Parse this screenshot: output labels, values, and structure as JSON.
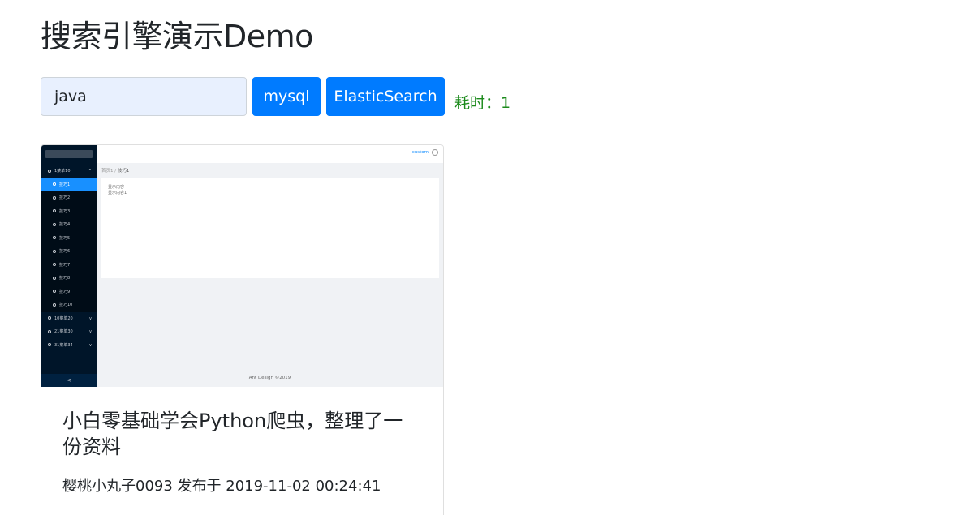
{
  "page": {
    "title": "搜索引擎演示Demo"
  },
  "search": {
    "value": "java",
    "placeholder": "",
    "mysql_label": "mysql",
    "es_label": "ElasticSearch",
    "elapsed_text": "耗时：1"
  },
  "results": [
    {
      "title": "小白零基础学会Python爬虫，整理了一份资料",
      "meta": "樱桃小丸子0093 发布于 2019-11-02 00:24:41",
      "thumbnail": {
        "header_link": "custom",
        "breadcrumb_root": "首页1",
        "breadcrumb_sep": "/",
        "breadcrumb_current": "技巧1",
        "content_lines": [
          "显示内容",
          "显示内容1"
        ],
        "footer": "Ant Design ©2019",
        "collapse": "<",
        "menu": [
          {
            "label": "1菜单10",
            "arrow": "^",
            "sub": false,
            "active": false
          },
          {
            "label": "技巧1",
            "arrow": "",
            "sub": true,
            "active": true
          },
          {
            "label": "技巧2",
            "arrow": "",
            "sub": true,
            "active": false
          },
          {
            "label": "技巧3",
            "arrow": "",
            "sub": true,
            "active": false
          },
          {
            "label": "技巧4",
            "arrow": "",
            "sub": true,
            "active": false
          },
          {
            "label": "技巧5",
            "arrow": "",
            "sub": true,
            "active": false
          },
          {
            "label": "技巧6",
            "arrow": "",
            "sub": true,
            "active": false
          },
          {
            "label": "技巧7",
            "arrow": "",
            "sub": true,
            "active": false
          },
          {
            "label": "技巧8",
            "arrow": "",
            "sub": true,
            "active": false
          },
          {
            "label": "技巧9",
            "arrow": "",
            "sub": true,
            "active": false
          },
          {
            "label": "技巧10",
            "arrow": "",
            "sub": true,
            "active": false
          },
          {
            "label": "10菜单20",
            "arrow": "v",
            "sub": false,
            "active": false
          },
          {
            "label": "21菜单30",
            "arrow": "v",
            "sub": false,
            "active": false
          },
          {
            "label": "31菜单34",
            "arrow": "v",
            "sub": false,
            "active": false
          }
        ]
      }
    }
  ],
  "colors": {
    "primary": "#007bff",
    "elapsed": "#1b8a1b",
    "input_bg": "#e8f0fe"
  }
}
